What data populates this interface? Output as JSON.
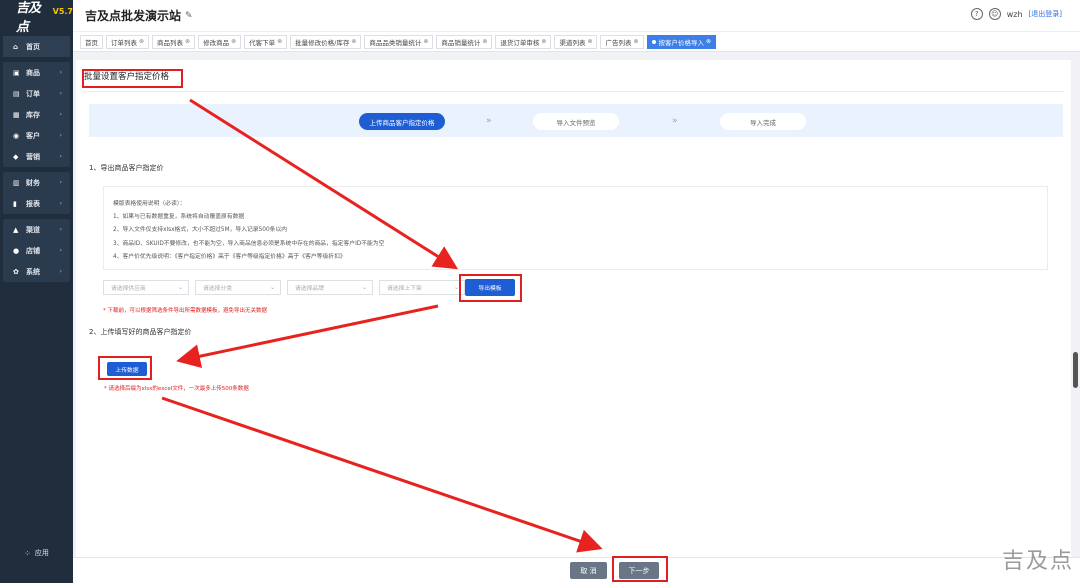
{
  "sidebar": {
    "logo": "吉及点",
    "version": "V5.7",
    "groups": [
      [
        {
          "icon": "home-icon",
          "glyph": "⌂",
          "label": "首页",
          "chevron": false
        }
      ],
      [
        {
          "icon": "cart-icon",
          "glyph": "▣",
          "label": "商品",
          "chevron": true
        },
        {
          "icon": "order-icon",
          "glyph": "▤",
          "label": "订单",
          "chevron": true
        },
        {
          "icon": "inventory-icon",
          "glyph": "▦",
          "label": "库存",
          "chevron": true
        },
        {
          "icon": "customer-icon",
          "glyph": "◉",
          "label": "客户",
          "chevron": true
        },
        {
          "icon": "marketing-icon",
          "glyph": "◆",
          "label": "营销",
          "chevron": true
        }
      ],
      [
        {
          "icon": "finance-icon",
          "glyph": "▥",
          "label": "财务",
          "chevron": true
        },
        {
          "icon": "report-icon",
          "glyph": "▮",
          "label": "报表",
          "chevron": true
        }
      ],
      [
        {
          "icon": "channel-icon",
          "glyph": "▲",
          "label": "渠道",
          "chevron": true
        },
        {
          "icon": "store-icon",
          "glyph": "●",
          "label": "店铺",
          "chevron": true
        },
        {
          "icon": "system-icon",
          "glyph": "✿",
          "label": "系统",
          "chevron": true
        }
      ]
    ],
    "apps_label": "应用"
  },
  "header": {
    "title": "吉及点批发演示站",
    "user": "wzh",
    "logout": "[退出登录]"
  },
  "tabs": [
    {
      "label": "首页",
      "closable": false,
      "active": false
    },
    {
      "label": "订单列表",
      "closable": true,
      "active": false
    },
    {
      "label": "商品列表",
      "closable": true,
      "active": false
    },
    {
      "label": "修改商品",
      "closable": true,
      "active": false
    },
    {
      "label": "代客下单",
      "closable": true,
      "active": false
    },
    {
      "label": "批量修改价格/库存",
      "closable": true,
      "active": false
    },
    {
      "label": "商品品类销量统计",
      "closable": true,
      "active": false
    },
    {
      "label": "商品销量统计",
      "closable": true,
      "active": false
    },
    {
      "label": "退货订单审核",
      "closable": true,
      "active": false
    },
    {
      "label": "渠道列表",
      "closable": true,
      "active": false
    },
    {
      "label": "广告列表",
      "closable": true,
      "active": false
    },
    {
      "label": "按客户价格导入",
      "closable": true,
      "active": true
    }
  ],
  "page": {
    "title": "批量设置客户指定价格",
    "steps": [
      "上传商品客户指定价格",
      "导入文件预览",
      "导入完成"
    ],
    "section1": "1、导出商品客户指定价",
    "notice": [
      "模版表格使用说明（必读）：",
      "1、如果与已有数据重复，系统将自动覆盖原有数据",
      "2、导入文件仅支持xlsx格式，大小不超过5M，导入记录500条以内",
      "3、商品ID、SKUID不要修改，也不能为空，导入商品信息必须是系统中存在的商品，指定客户ID不能为空",
      "4、客户价优先级说明：《客户指定价格》高于《客户等级指定价格》高于《客户等级折扣》"
    ],
    "filters": [
      "请选择供应商",
      "请选择分类",
      "请选择品牌",
      "请选择上下架"
    ],
    "export_button": "导出模板",
    "export_hint": "* 下载前，可以根据筛选条件导出所需数据模板，避免导出无关数据",
    "section2": "2、上传填写好的商品客户指定价",
    "upload_button": "上传数据",
    "upload_hint": "* 请选择后缀为xlsx的excel文件，一次最多上传500条数据"
  },
  "footer": {
    "cancel": "取 消",
    "next": "下一步"
  },
  "watermark": "吉及点",
  "colors": {
    "primary": "#1f5dd3",
    "annotation": "#e02020",
    "sidebar": "#1f2d3d"
  }
}
